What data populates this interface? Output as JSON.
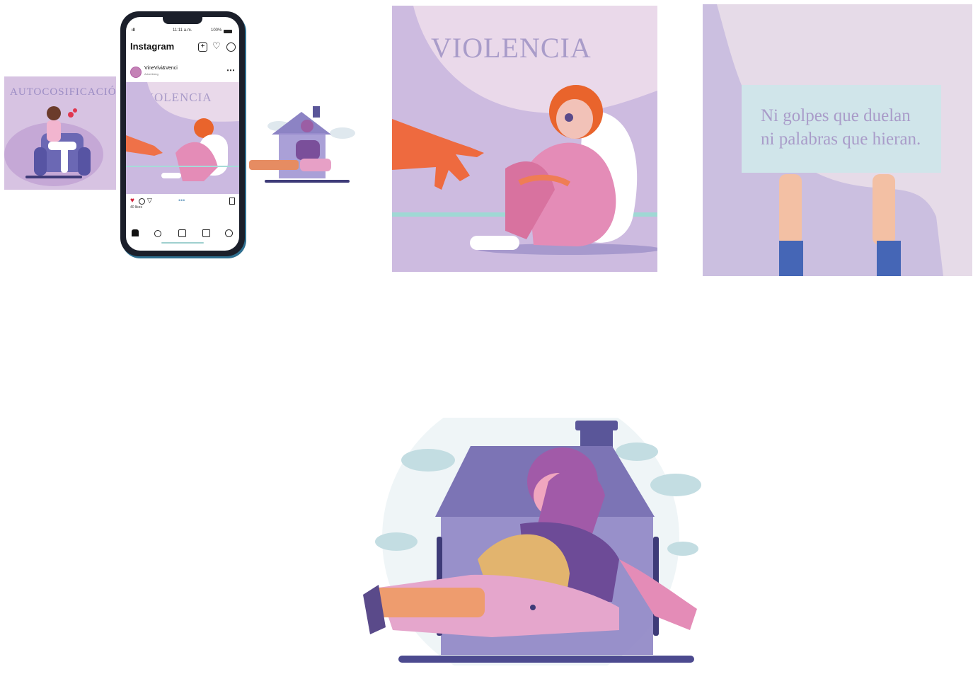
{
  "phone": {
    "status": {
      "signal": "ıll",
      "time": "11:11 a.m.",
      "battery": "100%"
    },
    "app_title": "Instagram",
    "post": {
      "username": "VineVivi&Venci",
      "sublabel": "Advertising",
      "likes": "40 likes"
    },
    "post_image_title": "VIOLENCIA",
    "icons": [
      "add-post-icon",
      "heart-icon",
      "messenger-icon",
      "more-icon",
      "like-heart-icon",
      "comment-icon",
      "share-icon",
      "bookmark-icon",
      "home-icon",
      "search-icon",
      "reels-icon",
      "shop-icon",
      "profile-icon"
    ]
  },
  "side_left": {
    "title": "AUTOCOSIFICACIÓN"
  },
  "panel_violencia": {
    "title": "VIOLENCIA"
  },
  "panel_sign": {
    "line1": "Ni golpes que duelan",
    "line2": "ni palabras que hieran."
  },
  "colors": {
    "lavender": "#d9c9e6",
    "purple": "#7c74b5",
    "pink": "#e48cb7",
    "orange": "#ef7148",
    "teal": "#c7e4e6",
    "navy": "#3e3b78"
  }
}
